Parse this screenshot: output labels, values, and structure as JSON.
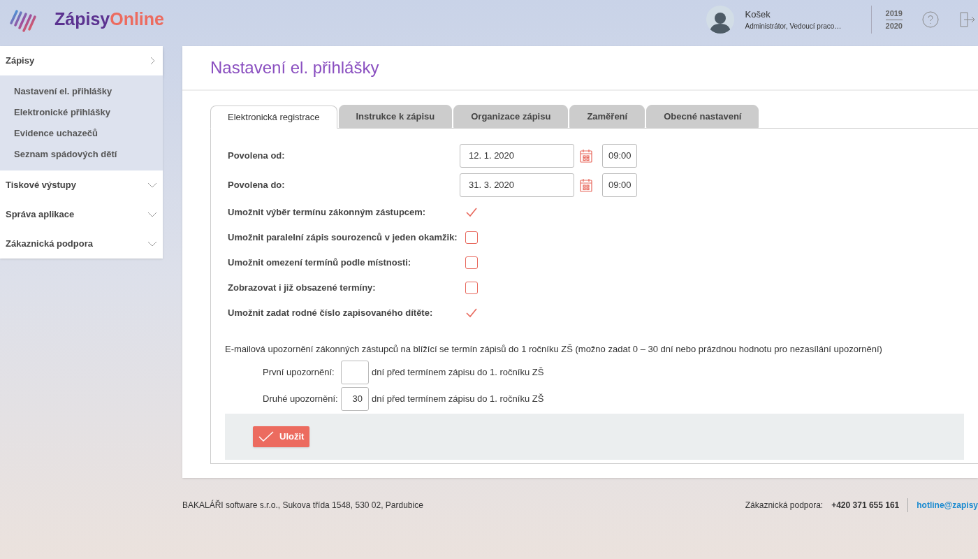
{
  "header": {
    "logo": {
      "first": "Zápisy",
      "second": "Online"
    },
    "user": {
      "name": "Košek",
      "role": "Administrátor, Vedoucí praco…"
    },
    "school_year": {
      "from": "2019",
      "to": "2020"
    }
  },
  "sidebar": {
    "items": [
      {
        "label": "Zápisy",
        "expanded": true,
        "children": [
          {
            "label": "Nastavení el. přihlášky"
          },
          {
            "label": "Elektronické přihlášky"
          },
          {
            "label": "Evidence uchazečů"
          },
          {
            "label": "Seznam spádových dětí"
          }
        ]
      },
      {
        "label": "Tiskové výstupy",
        "expanded": false
      },
      {
        "label": "Správa aplikace",
        "expanded": false
      },
      {
        "label": "Zákaznická podpora",
        "expanded": false
      }
    ]
  },
  "page_title": "Nastavení el. přihlášky",
  "tabs": [
    {
      "label": "Elektronická registrace",
      "selected": true
    },
    {
      "label": "Instrukce k zápisu",
      "selected": false
    },
    {
      "label": "Organizace zápisu",
      "selected": false
    },
    {
      "label": "Zaměření",
      "selected": false
    },
    {
      "label": "Obecné nastavení",
      "selected": false
    }
  ],
  "fields": [
    {
      "kind": "date",
      "label": "Povolena od:",
      "date": "12. 1. 2020",
      "time": "09:00"
    },
    {
      "kind": "date",
      "label": "Povolena do:",
      "date": "31. 3. 2020",
      "time": "09:00"
    },
    {
      "kind": "checkbox",
      "label": "Umožnit výběr termínu zákonným zástupcem:",
      "checked": true
    },
    {
      "kind": "checkbox",
      "label": "Umožnit paralelní zápis sourozenců v jeden okamžik:",
      "checked": false
    },
    {
      "kind": "checkbox",
      "label": "Umožnit omezení termínů podle místnosti:",
      "checked": false
    },
    {
      "kind": "checkbox",
      "label": "Zobrazovat i již obsazené termíny:",
      "checked": false
    },
    {
      "kind": "checkbox",
      "label": "Umožnit zadat rodné číslo zapisovaného dítěte:",
      "checked": true
    }
  ],
  "notice": "E-mailová upozornění zákonných zástupců na blížící se termín zápisů do 1 ročníku ZŠ (možno zadat 0 – 30 dní nebo prázdnou hodnotu pro nezasílání upozornění)",
  "reminders": [
    {
      "label": "První upozornění:",
      "suffix": "dní před termínem zápisu do 1. ročníku ZŠ"
    },
    {
      "label": "Druhé upozornění:",
      "value": "30",
      "suffix": "dní před termínem zápisu do 1. ročníku ZŠ"
    }
  ],
  "save_button": "Uložit",
  "footer": {
    "address": "BAKALÁŘI software s.r.o., Sukova třída 1548, 530 02, Pardubice",
    "support_label": "Zákaznická podpora:",
    "phone": "+420 371 655 161",
    "email": "hotline@zapisy"
  }
}
